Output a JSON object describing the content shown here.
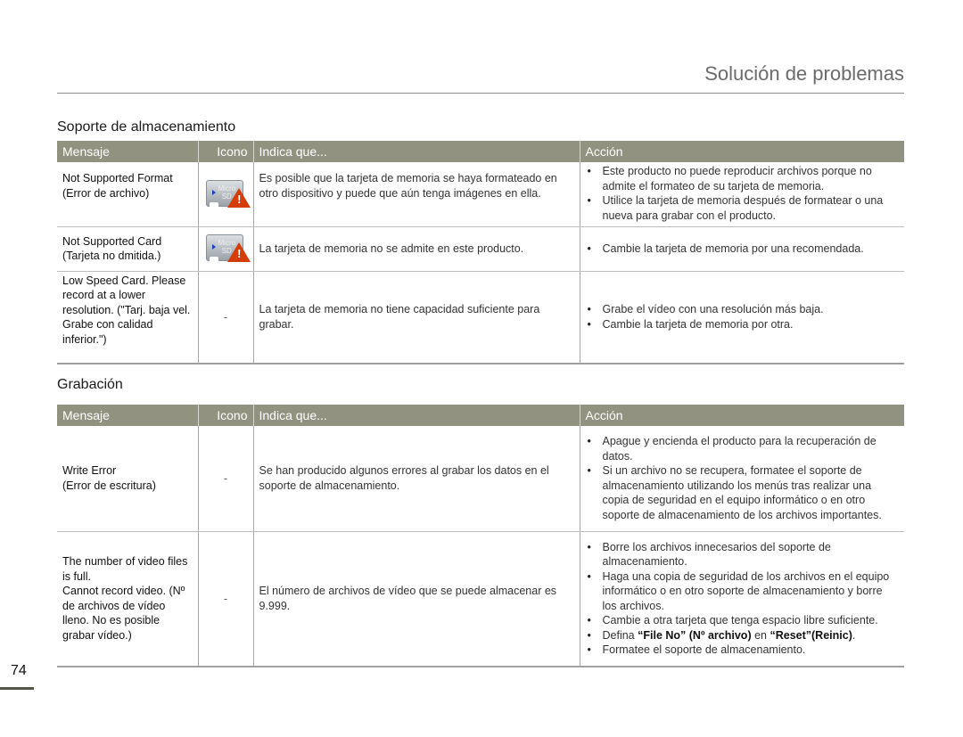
{
  "header": {
    "title": "Solución de problemas"
  },
  "sections": [
    {
      "title": "Soporte de almacenamiento",
      "columns": [
        "Mensaje",
        "Icono",
        "Indica que...",
        "Acción"
      ],
      "rows": [
        {
          "message": "Not Supported Format (Error de archivo)",
          "icon": "sd-card-warning-icon",
          "indicates": "Es posible que la tarjeta de memoria se haya formateado en otro dispositivo y puede que aún tenga imágenes en ella.",
          "actions": [
            "Este producto no puede reproducir archivos porque no admite el formateo de su tarjeta de memoria.",
            "Utilice la tarjeta de memoria después de formatear o una nueva para grabar con el producto."
          ]
        },
        {
          "message": "Not Supported Card (Tarjeta no dmitida.)",
          "icon": "sd-card-warning-icon",
          "indicates": "La tarjeta de memoria no se admite en este producto.",
          "actions": [
            "Cambie la tarjeta de memoria por una recomendada."
          ]
        },
        {
          "message": "Low Speed Card. Please record at a lower resolution. (\"Tarj. baja vel. Grabe con calidad inferior.\")",
          "icon_text": "-",
          "indicates": "La tarjeta de memoria no tiene capacidad suficiente para grabar.",
          "actions": [
            "Grabe el vídeo con una resolución más baja.",
            "Cambie la tarjeta de memoria por otra."
          ]
        }
      ]
    },
    {
      "title": "Grabación",
      "columns": [
        "Mensaje",
        "Icono",
        "Indica que...",
        "Acción"
      ],
      "rows": [
        {
          "message_lines": [
            "Write Error",
            "(Error de escritura)"
          ],
          "icon_text": "-",
          "indicates": "Se han producido algunos errores al grabar los datos en el soporte de almacenamiento.",
          "actions": [
            "Apague y encienda el producto para la recuperación de datos.",
            "Si un archivo no se recupera, formatee el soporte de almacenamiento utilizando los menús tras realizar una copia de seguridad en el equipo informático o en otro soporte de almacenamiento de los archivos importantes."
          ]
        },
        {
          "message_lines": [
            "The number of video files is full.",
            "Cannot record video. (Nº de archivos de vídeo lleno. No es posible grabar vídeo.)"
          ],
          "icon_text": "-",
          "indicates": "El número de archivos de vídeo que se puede almacenar es 9.999.",
          "actions": [
            "Borre los archivos innecesarios del soporte de almacenamiento.",
            "Haga una copia de seguridad de los archivos en el equipo informático o en otro soporte de almacenamiento y borre los archivos.",
            "Cambie a otra tarjeta que tenga espacio libre suficiente."
          ],
          "action_rich": {
            "prefix": "Defina ",
            "bold1": "“File No” (Nº archivo)",
            "middle": " en ",
            "bold2": "“Reset”(Reinic)",
            "suffix": "."
          },
          "action_last": "Formatee el soporte de almacenamiento."
        }
      ]
    }
  ],
  "footer": {
    "page_number": "74"
  }
}
